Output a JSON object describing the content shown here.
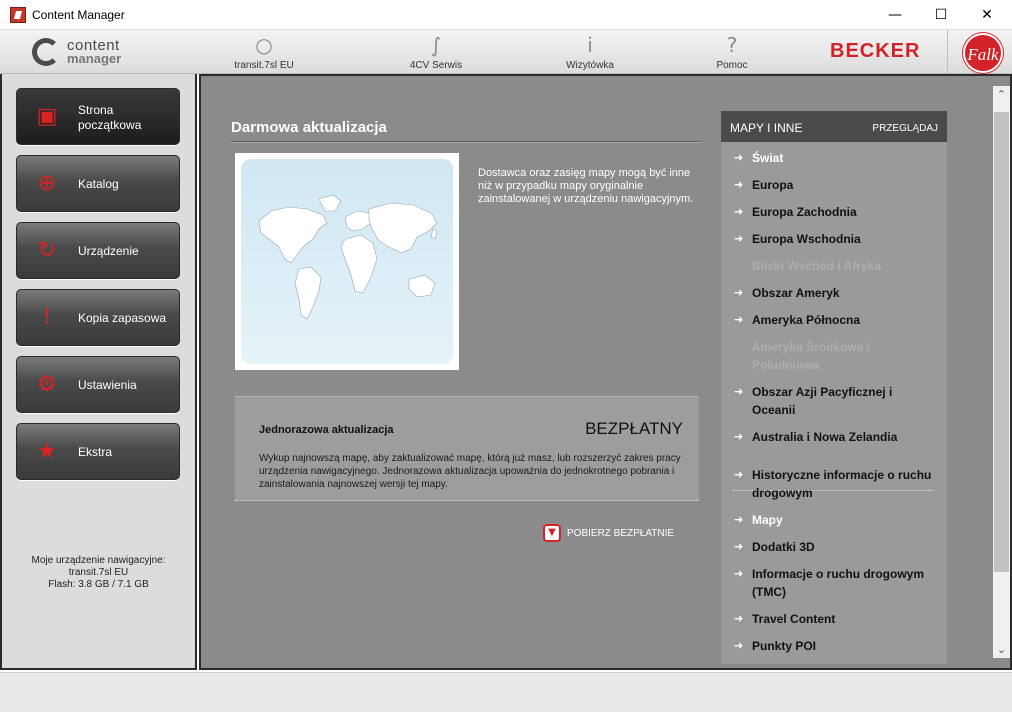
{
  "window": {
    "title": "Content Manager",
    "minimize_icon": "minimize-icon",
    "maximize_icon": "maximize-icon",
    "close_icon": "close-icon"
  },
  "logo": {
    "line1": "content",
    "line2": "manager"
  },
  "toolbar": {
    "items": [
      {
        "label": "transit.7sl EU",
        "icon": "device-icon"
      },
      {
        "label": "4CV Serwis",
        "icon": "service-icon"
      },
      {
        "label": "Wizytówka",
        "icon": "info-icon"
      },
      {
        "label": "Pomoc",
        "icon": "help-icon"
      }
    ],
    "brand1": "BECKER",
    "brand2": "Falk"
  },
  "sidebar": {
    "items": [
      {
        "label": "Strona początkowa",
        "icon": "home-icon",
        "active": true
      },
      {
        "label": "Katalog",
        "icon": "catalog-icon"
      },
      {
        "label": "Urządzenie",
        "icon": "device-sync-icon"
      },
      {
        "label": "Kopia zapasowa",
        "icon": "backup-icon"
      },
      {
        "label": "Ustawienia",
        "icon": "settings-icon"
      },
      {
        "label": "Ekstra",
        "icon": "extra-icon"
      }
    ],
    "device_heading": "Moje urządzenie nawigacyjne:",
    "device_name": "transit.7sl EU",
    "device_flash": "Flash: 3.8 GB / 7.1 GB"
  },
  "main": {
    "title": "Darmowa aktualizacja",
    "description": "Dostawca oraz zasięg mapy mogą być inne niż w przypadku mapy oryginalnie zainstalowanej w urządzeniu nawigacyjnym.",
    "offer": {
      "title": "Jednorazowa aktualizacja",
      "price": "BEZPŁATNY",
      "description": "Wykup najnowszą mapę, aby zaktualizować mapę, którą już masz, lub rozszerzyć zakres pracy urządzenia nawigacyjnego. Jednorazowa aktualizacja upoważnia do jednokrotnego pobrania i zainstalowania najnowszej wersji tej mapy."
    },
    "download_label": "POBIERZ BEZPŁATNIE"
  },
  "maps_panel": {
    "title": "MAPY I INNE",
    "browse": "PRZEGLĄDAJ",
    "items": [
      {
        "label": "Świat",
        "state": "selected"
      },
      {
        "label": "Europa",
        "state": "normal"
      },
      {
        "label": "Europa Zachodnia",
        "state": "normal"
      },
      {
        "label": "Europa Wschodnia",
        "state": "normal"
      },
      {
        "label": "Bliski Wschód i Afryka",
        "state": "disabled"
      },
      {
        "label": "Obszar Ameryk",
        "state": "normal"
      },
      {
        "label": "Ameryka Północna",
        "state": "normal"
      },
      {
        "label": "Ameryka Środkowa i Południowa",
        "state": "disabled"
      },
      {
        "label": "Obszar Azji Pacyficznej i Oceanii",
        "state": "normal"
      },
      {
        "label": "Australia i Nowa Zelandia",
        "state": "normal"
      },
      {
        "label": "Historyczne informacje o ruchu drogowym",
        "state": "normal"
      },
      {
        "label": "Mapy",
        "state": "selected"
      },
      {
        "label": "Dodatki 3D",
        "state": "normal"
      },
      {
        "label": "Informacje o ruchu drogowym (TMC)",
        "state": "normal"
      },
      {
        "label": "Travel Content",
        "state": "normal"
      },
      {
        "label": "Punkty POI",
        "state": "normal"
      }
    ]
  }
}
